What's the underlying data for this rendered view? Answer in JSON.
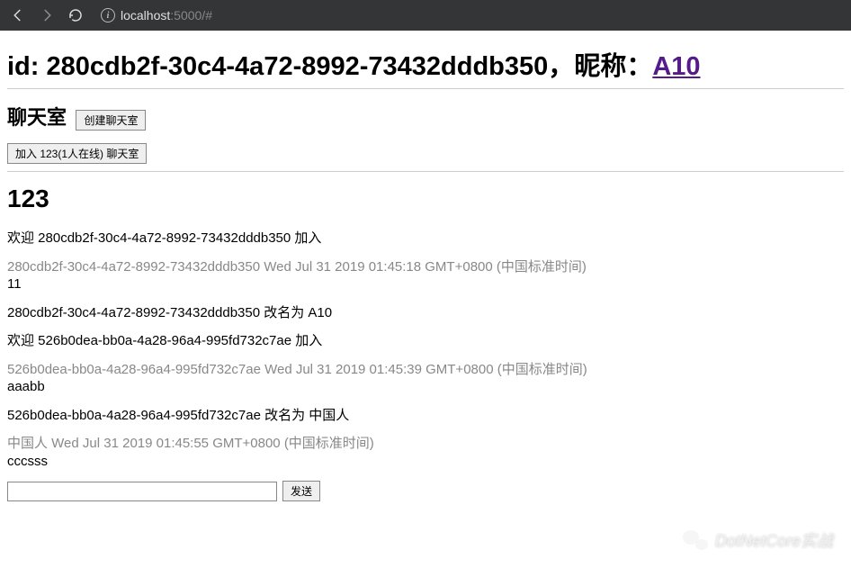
{
  "browser": {
    "url_host": "localhost",
    "url_rest": ":5000/#"
  },
  "header": {
    "id_label": "id: ",
    "id_value": "280cdb2f-30c4-4a72-8992-73432dddb350",
    "sep": "，",
    "nickname_label": "昵称：",
    "nickname_value": "A10"
  },
  "rooms": {
    "section_title": "聊天室",
    "create_label": "创建聊天室",
    "join_label": "加入 123(1人在线) 聊天室"
  },
  "current_room": {
    "name": "123"
  },
  "messages": [
    {
      "type": "system",
      "text": "欢迎 280cdb2f-30c4-4a72-8992-73432dddb350 加入"
    },
    {
      "type": "chat",
      "meta": "280cdb2f-30c4-4a72-8992-73432dddb350 Wed Jul 31 2019 01:45:18 GMT+0800 (中国标准时间)",
      "body": "11"
    },
    {
      "type": "system",
      "text": "280cdb2f-30c4-4a72-8992-73432dddb350 改名为 A10"
    },
    {
      "type": "system",
      "text": "欢迎 526b0dea-bb0a-4a28-96a4-995fd732c7ae 加入"
    },
    {
      "type": "chat",
      "meta": "526b0dea-bb0a-4a28-96a4-995fd732c7ae Wed Jul 31 2019 01:45:39 GMT+0800 (中国标准时间)",
      "body": "aaabb"
    },
    {
      "type": "system",
      "text": "526b0dea-bb0a-4a28-96a4-995fd732c7ae 改名为 中国人"
    },
    {
      "type": "chat",
      "meta": "中国人 Wed Jul 31 2019 01:45:55 GMT+0800 (中国标准时间)",
      "body": "cccsss"
    }
  ],
  "input": {
    "value": "",
    "send_label": "发送"
  },
  "watermark": {
    "text": "DotNetCore实战"
  }
}
